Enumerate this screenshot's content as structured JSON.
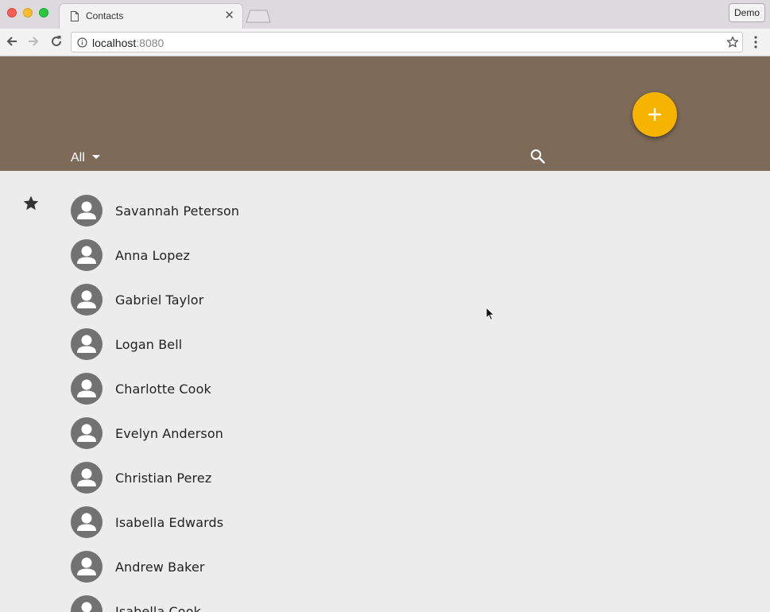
{
  "browser": {
    "tab_title": "Contacts",
    "tab_close": "✕",
    "profile_label": "Demo",
    "url_host": "localhost",
    "url_port": ":8080"
  },
  "app": {
    "header_color": "#7d6a58",
    "fab_color": "#f6b400",
    "filter_label": "All",
    "contacts": [
      {
        "name": "Savannah Peterson",
        "favorite": true
      },
      {
        "name": "Anna Lopez",
        "favorite": false
      },
      {
        "name": "Gabriel Taylor",
        "favorite": false
      },
      {
        "name": "Logan Bell",
        "favorite": false
      },
      {
        "name": "Charlotte Cook",
        "favorite": false
      },
      {
        "name": "Evelyn Anderson",
        "favorite": false
      },
      {
        "name": "Christian Perez",
        "favorite": false
      },
      {
        "name": "Isabella Edwards",
        "favorite": false
      },
      {
        "name": "Andrew Baker",
        "favorite": false
      },
      {
        "name": "Isabella Cook",
        "favorite": false
      }
    ]
  }
}
